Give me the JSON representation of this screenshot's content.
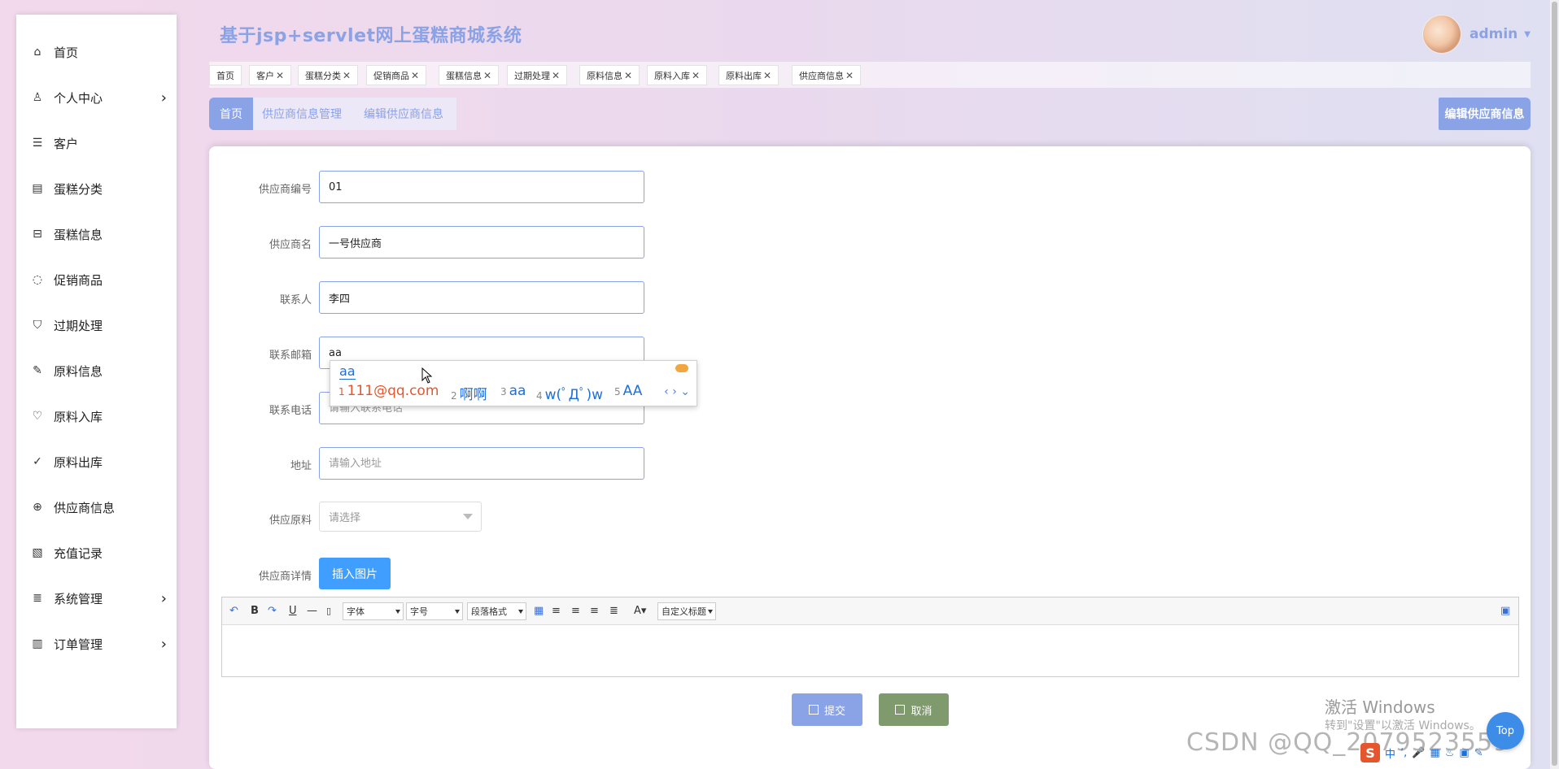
{
  "app": {
    "title": "基于jsp+servlet网上蛋糕商城系统",
    "username": "admin",
    "accent_color": "#8aa2e6"
  },
  "sidebar": {
    "items": [
      {
        "label": "首页",
        "icon": "home-icon",
        "has_arrow": false
      },
      {
        "label": "个人中心",
        "icon": "user-icon",
        "has_arrow": true
      },
      {
        "label": "客户",
        "icon": "list-icon",
        "has_arrow": false
      },
      {
        "label": "蛋糕分类",
        "icon": "category-icon",
        "has_arrow": false
      },
      {
        "label": "蛋糕信息",
        "icon": "info-icon",
        "has_arrow": false
      },
      {
        "label": "促销商品",
        "icon": "chat-icon",
        "has_arrow": false
      },
      {
        "label": "过期处理",
        "icon": "shield-icon",
        "has_arrow": false
      },
      {
        "label": "原料信息",
        "icon": "edit-icon",
        "has_arrow": false
      },
      {
        "label": "原料入库",
        "icon": "heart-icon",
        "has_arrow": false
      },
      {
        "label": "原料出库",
        "icon": "check-circle-icon",
        "has_arrow": false
      },
      {
        "label": "供应商信息",
        "icon": "plus-circle-icon",
        "has_arrow": false
      },
      {
        "label": "充值记录",
        "icon": "image-icon",
        "has_arrow": false
      },
      {
        "label": "系统管理",
        "icon": "settings-list-icon",
        "has_arrow": true
      },
      {
        "label": "订单管理",
        "icon": "bar-chart-icon",
        "has_arrow": true
      }
    ],
    "arrow_glyph": "›"
  },
  "tabs": {
    "items": [
      {
        "label": "首页",
        "closable": false
      },
      {
        "label": "客户",
        "closable": true
      },
      {
        "label": "蛋糕分类",
        "closable": true
      },
      {
        "label": "促销商品",
        "closable": true
      },
      {
        "label": "蛋糕信息",
        "closable": true
      },
      {
        "label": "过期处理",
        "closable": true
      },
      {
        "label": "原料信息",
        "closable": true
      },
      {
        "label": "原料入库",
        "closable": true
      },
      {
        "label": "原料出库",
        "closable": true
      },
      {
        "label": "供应商信息",
        "closable": true
      }
    ],
    "close_glyph": "✕"
  },
  "breadcrumb": {
    "home": "首页",
    "items": [
      "供应商信息管理",
      "编辑供应商信息"
    ],
    "page_heading": "编辑供应商信息"
  },
  "form": {
    "supplier_no": {
      "label": "供应商编号",
      "value": "01",
      "placeholder": ""
    },
    "supplier_name": {
      "label": "供应商名",
      "value": "一号供应商",
      "placeholder": ""
    },
    "contact": {
      "label": "联系人",
      "value": "李四",
      "placeholder": ""
    },
    "email": {
      "label": "联系邮箱",
      "value": "aa",
      "placeholder": ""
    },
    "phone": {
      "label": "联系电话",
      "value": "",
      "placeholder": "请输入联系电话"
    },
    "address": {
      "label": "地址",
      "value": "",
      "placeholder": "请输入地址"
    },
    "materials": {
      "label": "供应原料",
      "placeholder": "请选择"
    },
    "details": {
      "label": "供应商详情",
      "insert_image": "插入图片"
    }
  },
  "editor_toolbar": {
    "font": "字体",
    "size": "字号",
    "paragraph": "段落格式",
    "custom_title": "自定义标题"
  },
  "actions": {
    "submit": "提交",
    "cancel": "取消"
  },
  "ime": {
    "composition": "aa",
    "candidates": [
      {
        "num": "1",
        "text": "111@qq.com"
      },
      {
        "num": "2",
        "text": "啊啊"
      },
      {
        "num": "3",
        "text": "aa"
      },
      {
        "num": "4",
        "text": "w(ﾟДﾟ)w"
      },
      {
        "num": "5",
        "text": "AA"
      }
    ],
    "nav": "‹ › ⌄"
  },
  "watermarks": {
    "windows_title": "激活 Windows",
    "windows_sub": "转到\"设置\"以激活 Windows。",
    "csdn": "CSDN @QQ_2079523559",
    "float_btn": "Top"
  }
}
